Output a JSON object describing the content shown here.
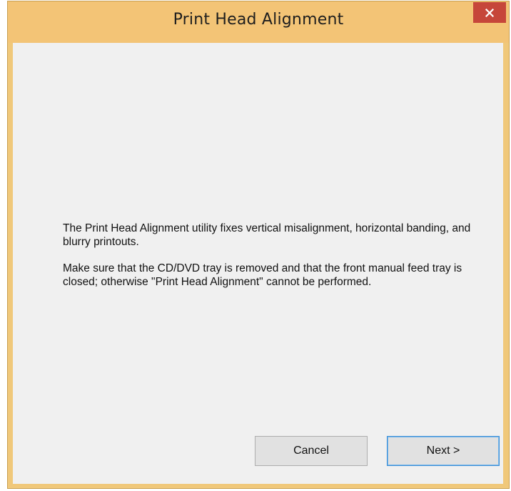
{
  "window": {
    "title": "Print Head Alignment",
    "close_icon": "close-icon"
  },
  "message": {
    "paragraph1": "The Print Head Alignment utility fixes vertical misalignment, horizontal banding, and blurry printouts.",
    "paragraph2": "Make sure that the CD/DVD tray is removed and that the front manual feed tray is closed; otherwise \"Print Head Alignment\" cannot be performed."
  },
  "buttons": {
    "cancel_label": "Cancel",
    "next_label": "Next >"
  },
  "colors": {
    "titlebar": "#f3c476",
    "close_button": "#c6463a",
    "client_background": "#f0f0f0"
  }
}
